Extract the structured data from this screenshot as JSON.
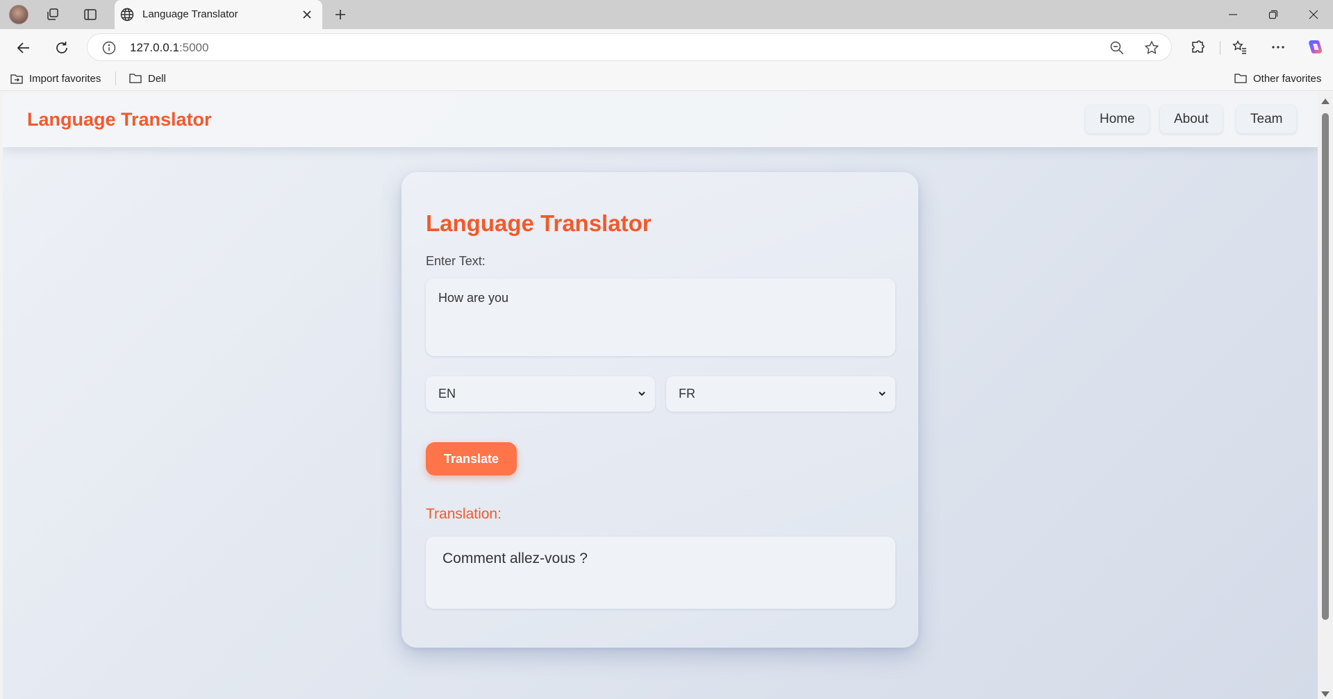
{
  "browser": {
    "tab_title": "Language Translator",
    "url_host": "127.0.0.1",
    "url_port": ":5000",
    "favorites": [
      "Import favorites",
      "Dell"
    ],
    "other_favorites": "Other favorites"
  },
  "header": {
    "brand": "Language Translator",
    "nav": [
      "Home",
      "About",
      "Team"
    ]
  },
  "translator": {
    "title": "Language Translator",
    "input_label": "Enter Text:",
    "input_value": "How are you",
    "source_lang": "EN",
    "target_lang": "FR",
    "button_label": "Translate",
    "result_label": "Translation:",
    "result_text": "Comment allez-vous ?"
  },
  "colors": {
    "accent": "#f15a2b",
    "button": "#ff7449"
  }
}
